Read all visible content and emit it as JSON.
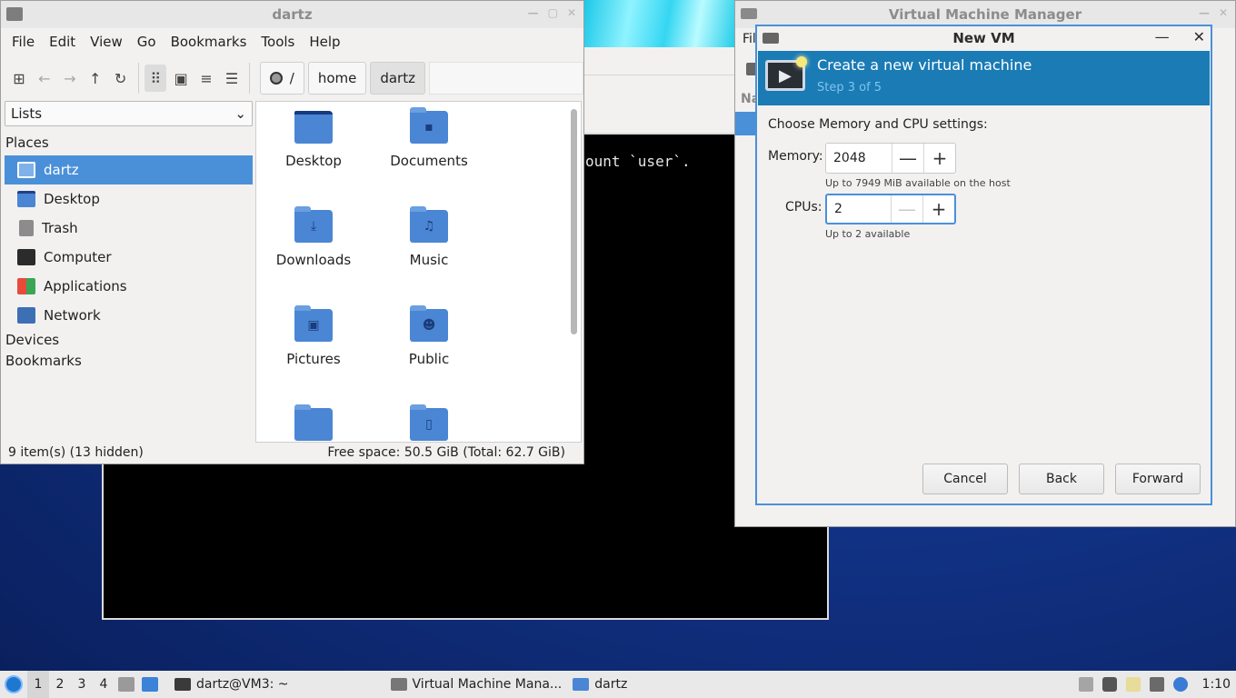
{
  "terminal": {
    "visible_text": "ount `user`."
  },
  "file_manager": {
    "title": "dartz",
    "menu": [
      "File",
      "Edit",
      "View",
      "Go",
      "Bookmarks",
      "Tools",
      "Help"
    ],
    "path": {
      "root": "/",
      "segments": [
        "home",
        "dartz"
      ]
    },
    "side_select": "Lists",
    "places_heading": "Places",
    "places": [
      {
        "label": "dartz",
        "icon": "home-folder-icon"
      },
      {
        "label": "Desktop",
        "icon": "desktop-icon"
      },
      {
        "label": "Trash",
        "icon": "trash-icon"
      },
      {
        "label": "Computer",
        "icon": "computer-icon"
      },
      {
        "label": "Applications",
        "icon": "applications-icon"
      },
      {
        "label": "Network",
        "icon": "network-icon"
      }
    ],
    "devices_heading": "Devices",
    "bookmarks_heading": "Bookmarks",
    "files": [
      {
        "label": "Desktop",
        "icon": "desktop-folder-icon"
      },
      {
        "label": "Documents",
        "icon": "documents-folder-icon"
      },
      {
        "label": "Downloads",
        "icon": "downloads-folder-icon"
      },
      {
        "label": "Music",
        "icon": "music-folder-icon"
      },
      {
        "label": "Pictures",
        "icon": "pictures-folder-icon"
      },
      {
        "label": "Public",
        "icon": "public-folder-icon"
      },
      {
        "label": "",
        "icon": "folder-icon"
      },
      {
        "label": "",
        "icon": "templates-folder-icon"
      }
    ],
    "status_left": "9 item(s) (13 hidden)",
    "status_right": "Free space: 50.5 GiB (Total: 62.7 GiB)"
  },
  "vmm": {
    "title": "Virtual Machine Manager",
    "menu_partial": "Fil",
    "column_partial": "Na"
  },
  "new_vm": {
    "title": "New VM",
    "header_title": "Create a new virtual machine",
    "header_step": "Step 3 of 5",
    "intro": "Choose Memory and CPU settings:",
    "memory_label": "Memory:",
    "memory_value": "2048",
    "memory_hint": "Up to 7949 MiB available on the host",
    "cpus_label": "CPUs:",
    "cpus_value": "2",
    "cpus_hint": "Up to 2 available",
    "buttons": {
      "cancel": "Cancel",
      "back": "Back",
      "forward": "Forward"
    }
  },
  "taskbar": {
    "workspaces": [
      "1",
      "2",
      "3",
      "4"
    ],
    "active_workspace": "1",
    "tasks": [
      {
        "label": "dartz@VM3: ~",
        "icon": "terminal-icon"
      },
      {
        "label": "Virtual Machine Mana...",
        "icon": "virt-manager-icon"
      },
      {
        "label": "dartz",
        "icon": "folder-icon"
      }
    ],
    "clock": "1:10"
  },
  "colors": {
    "accent": "#4a90d9",
    "header_blue": "#1a7bb5",
    "folder_blue": "#4a86d4"
  }
}
